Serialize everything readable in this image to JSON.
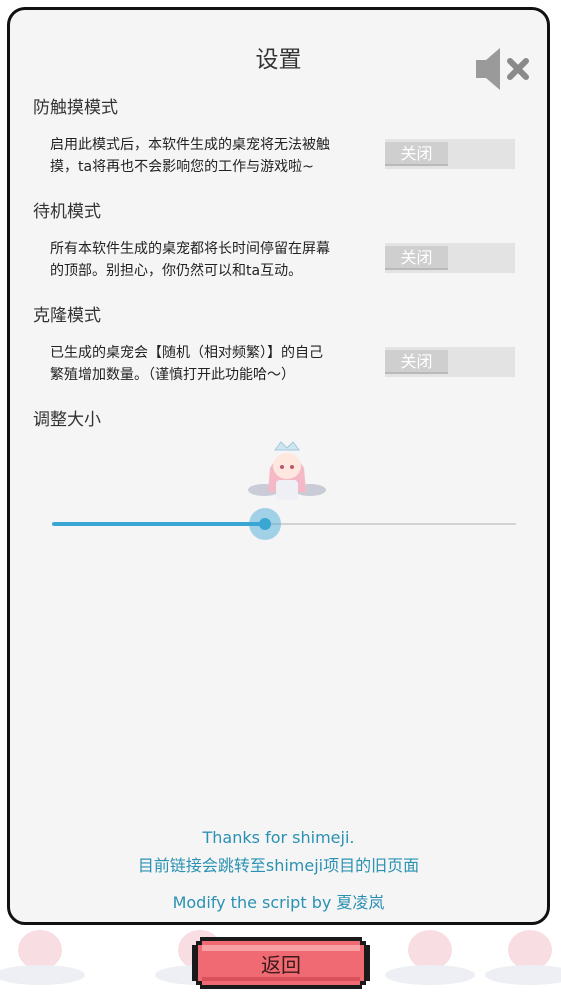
{
  "header": {
    "title": "设置"
  },
  "icons": {
    "sound": "speaker-muted-icon",
    "pet": "angel-pet-sprite"
  },
  "sections": [
    {
      "title": "防触摸模式",
      "desc_line1": "启用此模式后，本软件生成的桌宠将无法被触",
      "desc_line2": "摸，ta将再也不会影响您的工作与游戏啦~",
      "toggle_label": "关闭"
    },
    {
      "title": "待机模式",
      "desc_line1": "所有本软件生成的桌宠都将长时间停留在屏幕",
      "desc_line2": "的顶部。别担心，你仍然可以和ta互动。",
      "toggle_label": "关闭"
    },
    {
      "title": "克隆模式",
      "desc_line1": "已生成的桌宠会【随机（相对频繁）】的自己",
      "desc_line2": "繁殖增加数量。（谨慎打开此功能哈～）",
      "toggle_label": "关闭"
    }
  ],
  "resize": {
    "title": "调整大小",
    "value": 0.46
  },
  "credits": {
    "line1": "Thanks for shimeji.",
    "line2": "目前链接会跳转至shimeji项目的旧页面",
    "line3": "Modify the script by 夏凌岚"
  },
  "footer": {
    "back_label": "返回"
  },
  "colors": {
    "accent": "#39a6d4",
    "link": "#2a91b3",
    "back_button": "#f06a73",
    "toggle_off": "#cfcfcf"
  }
}
